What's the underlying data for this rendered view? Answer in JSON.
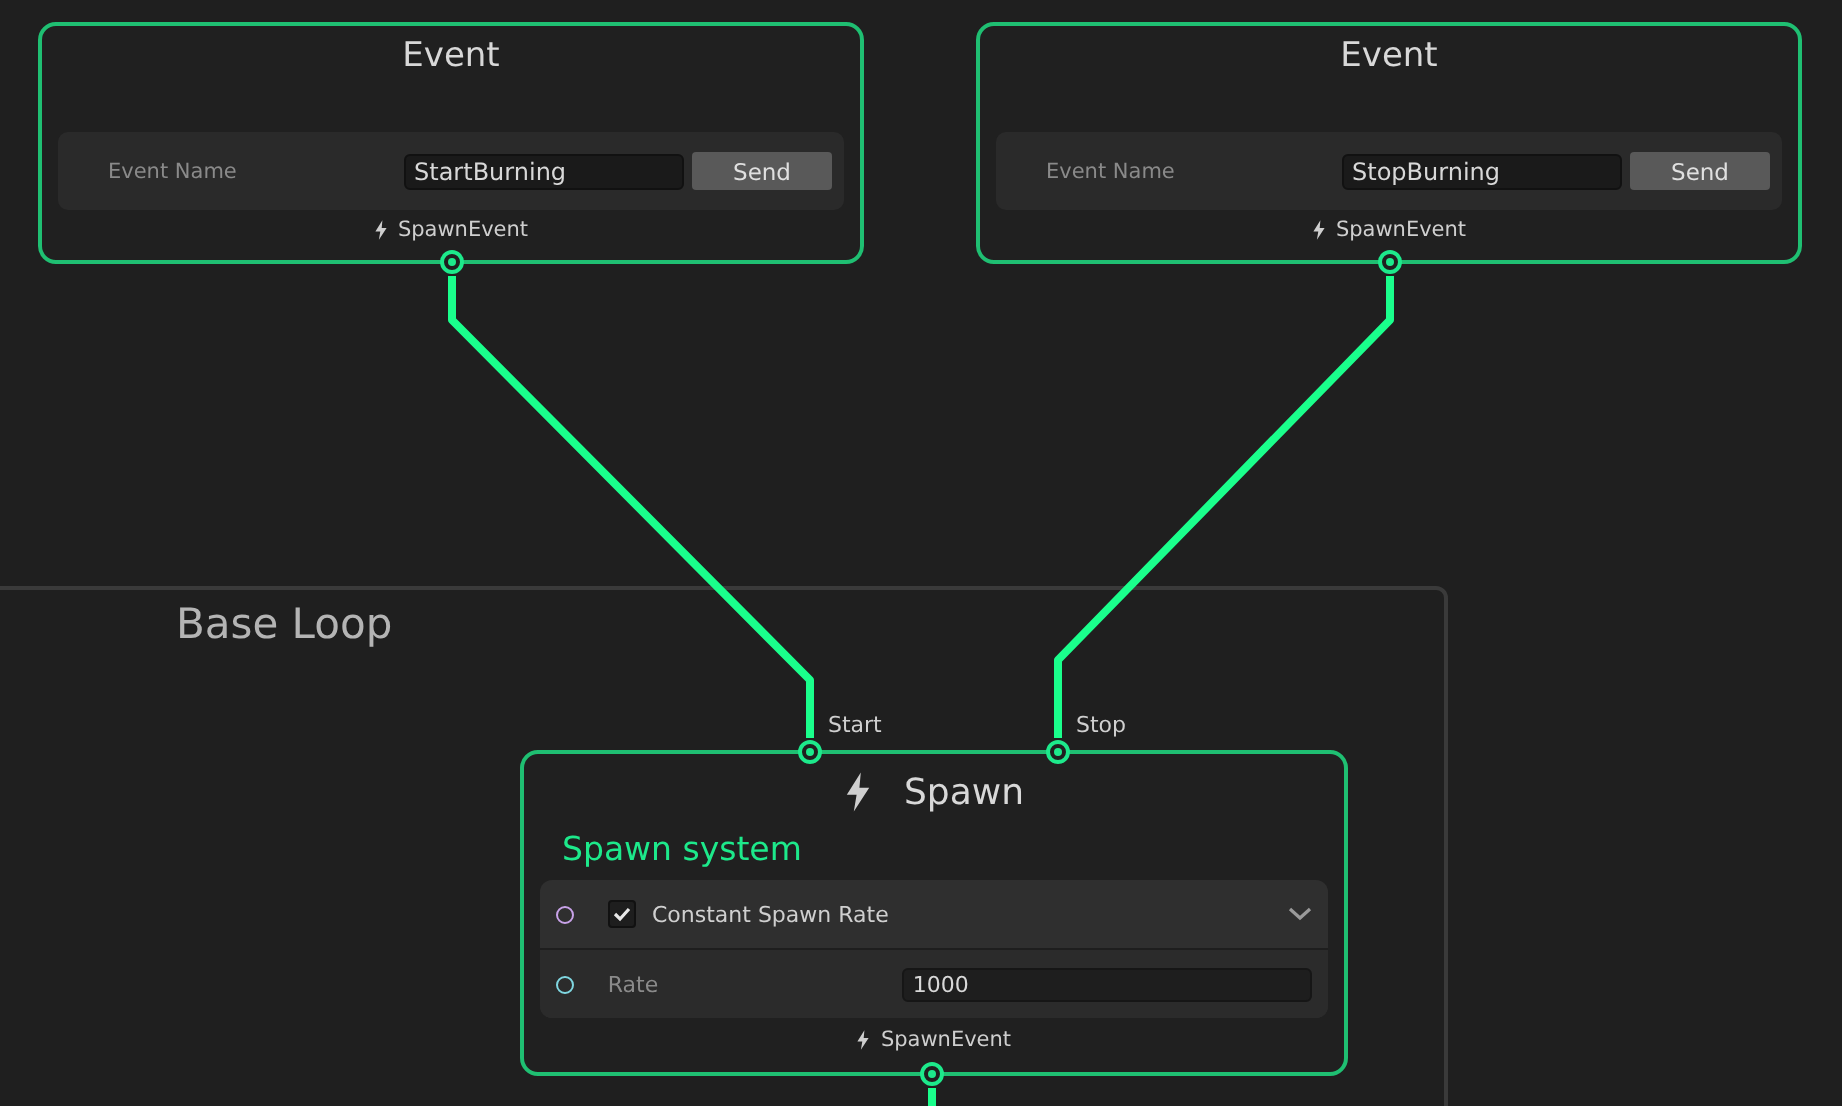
{
  "event_nodes": [
    {
      "title": "Event",
      "field_label": "Event Name",
      "field_value": "StartBurning",
      "button": "Send",
      "output_port": "SpawnEvent"
    },
    {
      "title": "Event",
      "field_label": "Event Name",
      "field_value": "StopBurning",
      "button": "Send",
      "output_port": "SpawnEvent"
    }
  ],
  "group": {
    "title": "Base Loop"
  },
  "spawn_node": {
    "title": "Spawn",
    "subtitle": "Spawn system",
    "inputs": [
      {
        "label": "Start"
      },
      {
        "label": "Stop"
      }
    ],
    "blocks": [
      {
        "kind": "toggle",
        "label": "Constant Spawn Rate",
        "checked": true,
        "color": "#c8a2e8"
      },
      {
        "kind": "field",
        "label": "Rate",
        "value": "1000",
        "color": "#7fd6e0"
      }
    ],
    "output_port": "SpawnEvent"
  }
}
